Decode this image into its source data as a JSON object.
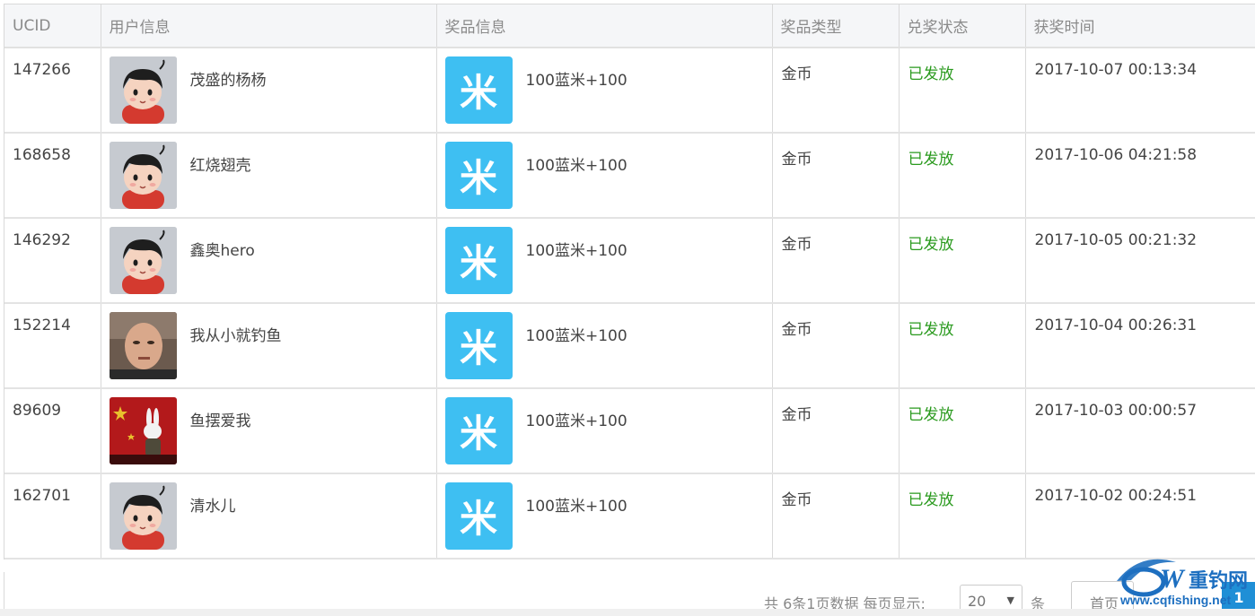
{
  "columns": [
    "UCID",
    "用户信息",
    "奖品信息",
    "奖品类型",
    "兑奖状态",
    "获奖时间"
  ],
  "rows": [
    {
      "ucid": "147266",
      "avatar": "cartoon-avatar",
      "nickname": "茂盛的杨杨",
      "prize_icon": "米",
      "prize": "100蓝米+100",
      "type": "金币",
      "status": "已发放",
      "time": "2017-10-07 00:13:34"
    },
    {
      "ucid": "168658",
      "avatar": "cartoon-avatar",
      "nickname": "红烧翅壳",
      "prize_icon": "米",
      "prize": "100蓝米+100",
      "type": "金币",
      "status": "已发放",
      "time": "2017-10-06 04:21:58"
    },
    {
      "ucid": "146292",
      "avatar": "cartoon-avatar",
      "nickname": "鑫奥hero",
      "prize_icon": "米",
      "prize": "100蓝米+100",
      "type": "金币",
      "status": "已发放",
      "time": "2017-10-05 00:21:32"
    },
    {
      "ucid": "152214",
      "avatar": "photo-avatar",
      "nickname": "我从小就钓鱼",
      "prize_icon": "米",
      "prize": "100蓝米+100",
      "type": "金币",
      "status": "已发放",
      "time": "2017-10-04 00:26:31"
    },
    {
      "ucid": "89609",
      "avatar": "rabbit-avatar",
      "nickname": "鱼摆爱我",
      "prize_icon": "米",
      "prize": "100蓝米+100",
      "type": "金币",
      "status": "已发放",
      "time": "2017-10-03 00:00:57"
    },
    {
      "ucid": "162701",
      "avatar": "cartoon-avatar",
      "nickname": "清水儿",
      "prize_icon": "米",
      "prize": "100蓝米+100",
      "type": "金币",
      "status": "已发放",
      "time": "2017-10-02 00:24:51"
    }
  ],
  "pagination": {
    "summary": "共 6条1页数据 每页显示:",
    "page_size": "20",
    "unit": "条",
    "first_label": "首页",
    "current_page": "1"
  },
  "watermark": {
    "brand": "重钓网",
    "url": "www.cqfishing.net"
  },
  "colors": {
    "header_bg": "#f5f6f8",
    "status_green": "#2a9a1e",
    "prize_icon_blue": "#3ebff2",
    "page_active_blue": "#1f8fd6"
  }
}
